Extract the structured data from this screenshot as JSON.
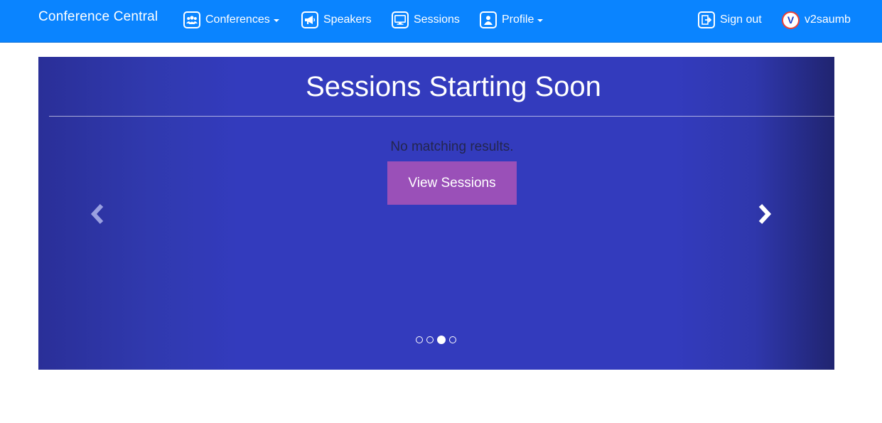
{
  "nav": {
    "brand": "Conference Central",
    "items": [
      {
        "label": "Conferences",
        "icon": "users-icon",
        "dropdown": true
      },
      {
        "label": "Speakers",
        "icon": "megaphone-icon",
        "dropdown": false
      },
      {
        "label": "Sessions",
        "icon": "monitor-icon",
        "dropdown": false
      },
      {
        "label": "Profile",
        "icon": "user-icon",
        "dropdown": true
      }
    ],
    "sign_out": "Sign out",
    "user": {
      "initial": "V",
      "name": "v2saumb"
    }
  },
  "carousel": {
    "title": "Sessions Starting Soon",
    "empty_message": "No matching results.",
    "button_label": "View Sessions",
    "slide_count": 4,
    "active_slide": 3
  },
  "colors": {
    "navbar": "#0a84ff",
    "carousel_bg": "#333bbd",
    "button": "#9a50b8"
  }
}
